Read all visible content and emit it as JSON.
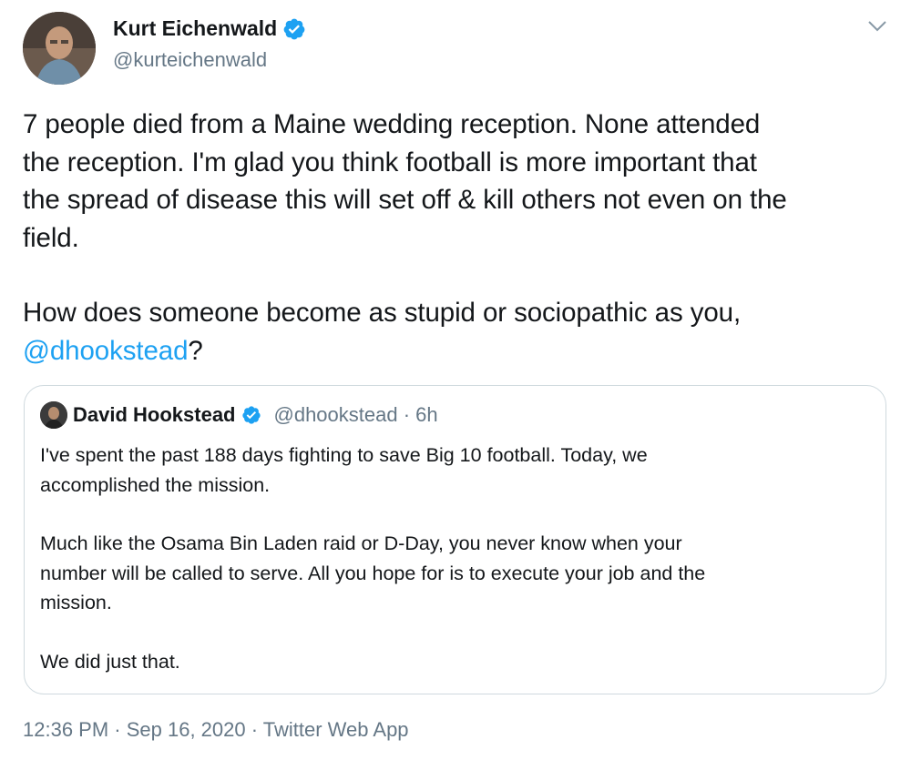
{
  "author": {
    "name": "Kurt Eichenwald",
    "handle": "@kurteichenwald",
    "verified_icon": "verified-badge-icon"
  },
  "tweet": {
    "lines": [
      "7 people died from a Maine wedding reception. None  attended",
      "the reception. I'm glad you think football is more important that",
      "the spread of disease this will set off & kill others not even on the",
      "field."
    ],
    "question_text": "How does someone become as stupid or sociopathic as you,",
    "mention": "@dhookstead",
    "question_end": "?"
  },
  "quoted": {
    "name": "David Hookstead",
    "handle_time": "@dhookstead · 6h",
    "para1_line1": "I've spent the past 188 days fighting to save Big 10 football. Today, we",
    "para1_line2": "accomplished the mission.",
    "para2_line1": "Much like the Osama Bin Laden raid or D-Day, you never know when your",
    "para2_line2": "number will be called to serve. All you hope for is to execute your job and the",
    "para2_line3": "mission.",
    "para3": "We did just that."
  },
  "footer": {
    "meta": "12:36 PM · Sep 16, 2020 · Twitter Web App"
  },
  "colors": {
    "link": "#1da1f2",
    "secondary_text": "#657786",
    "border": "#cfd9de",
    "verified": "#1da1f2"
  }
}
